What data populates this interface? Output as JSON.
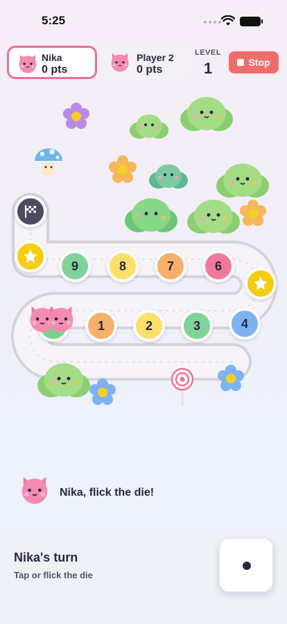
{
  "status_bar": {
    "time": "5:25"
  },
  "header": {
    "players": [
      {
        "name": "Nika",
        "score": "0 pts",
        "active": true
      },
      {
        "name": "Player 2",
        "score": "0 pts",
        "active": false
      }
    ],
    "level_label": "LEVEL",
    "level_value": "1",
    "stop_label": "Stop"
  },
  "board": {
    "tiles": [
      "1",
      "2",
      "3",
      "4",
      "6",
      "7",
      "8",
      "9"
    ]
  },
  "message": {
    "text": "Nika, flick the die!"
  },
  "bottom": {
    "turn_title": "Nika's turn",
    "turn_hint": "Tap or flick the die",
    "die_value": 1
  },
  "colors": {
    "accent_pink": "#ea6f9b",
    "stop_red": "#ef6c6c",
    "star_yellow": "#f4cc14"
  }
}
